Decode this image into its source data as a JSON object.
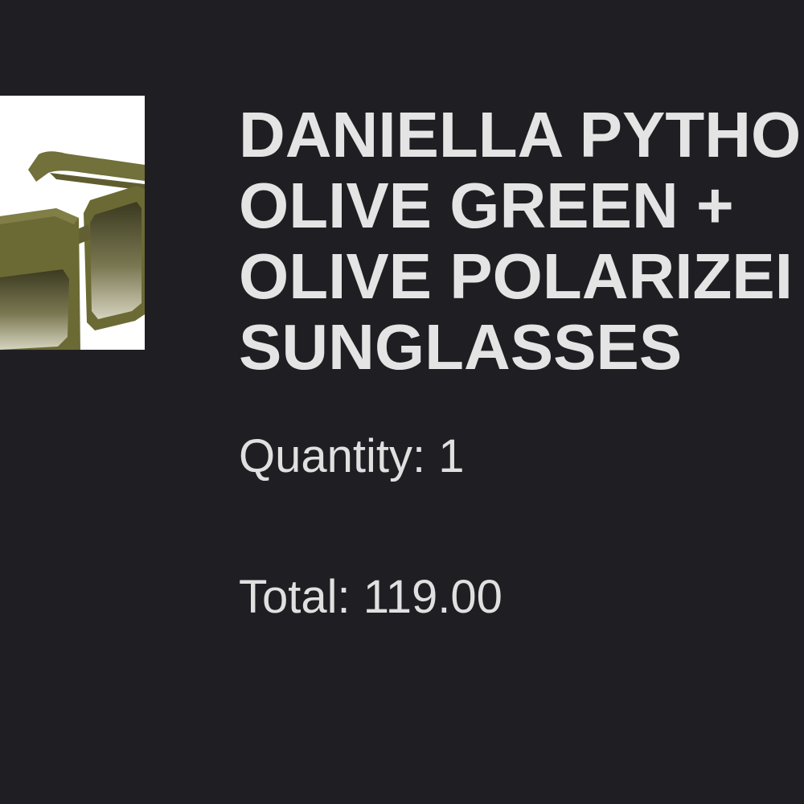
{
  "product": {
    "image_icon": "sunglasses-product-image",
    "frame_color": "#6b6a35",
    "lens_color": "#57552e",
    "title_lines": [
      "DANIELLA PYTHO",
      "OLIVE GREEN +",
      "OLIVE POLARIZEI",
      "SUNGLASSES"
    ]
  },
  "order": {
    "quantity_label": "Quantity: 1",
    "total_label": "Total: 119.00"
  },
  "colors": {
    "background": "#1f1f23",
    "text": "#e4e4e4"
  }
}
